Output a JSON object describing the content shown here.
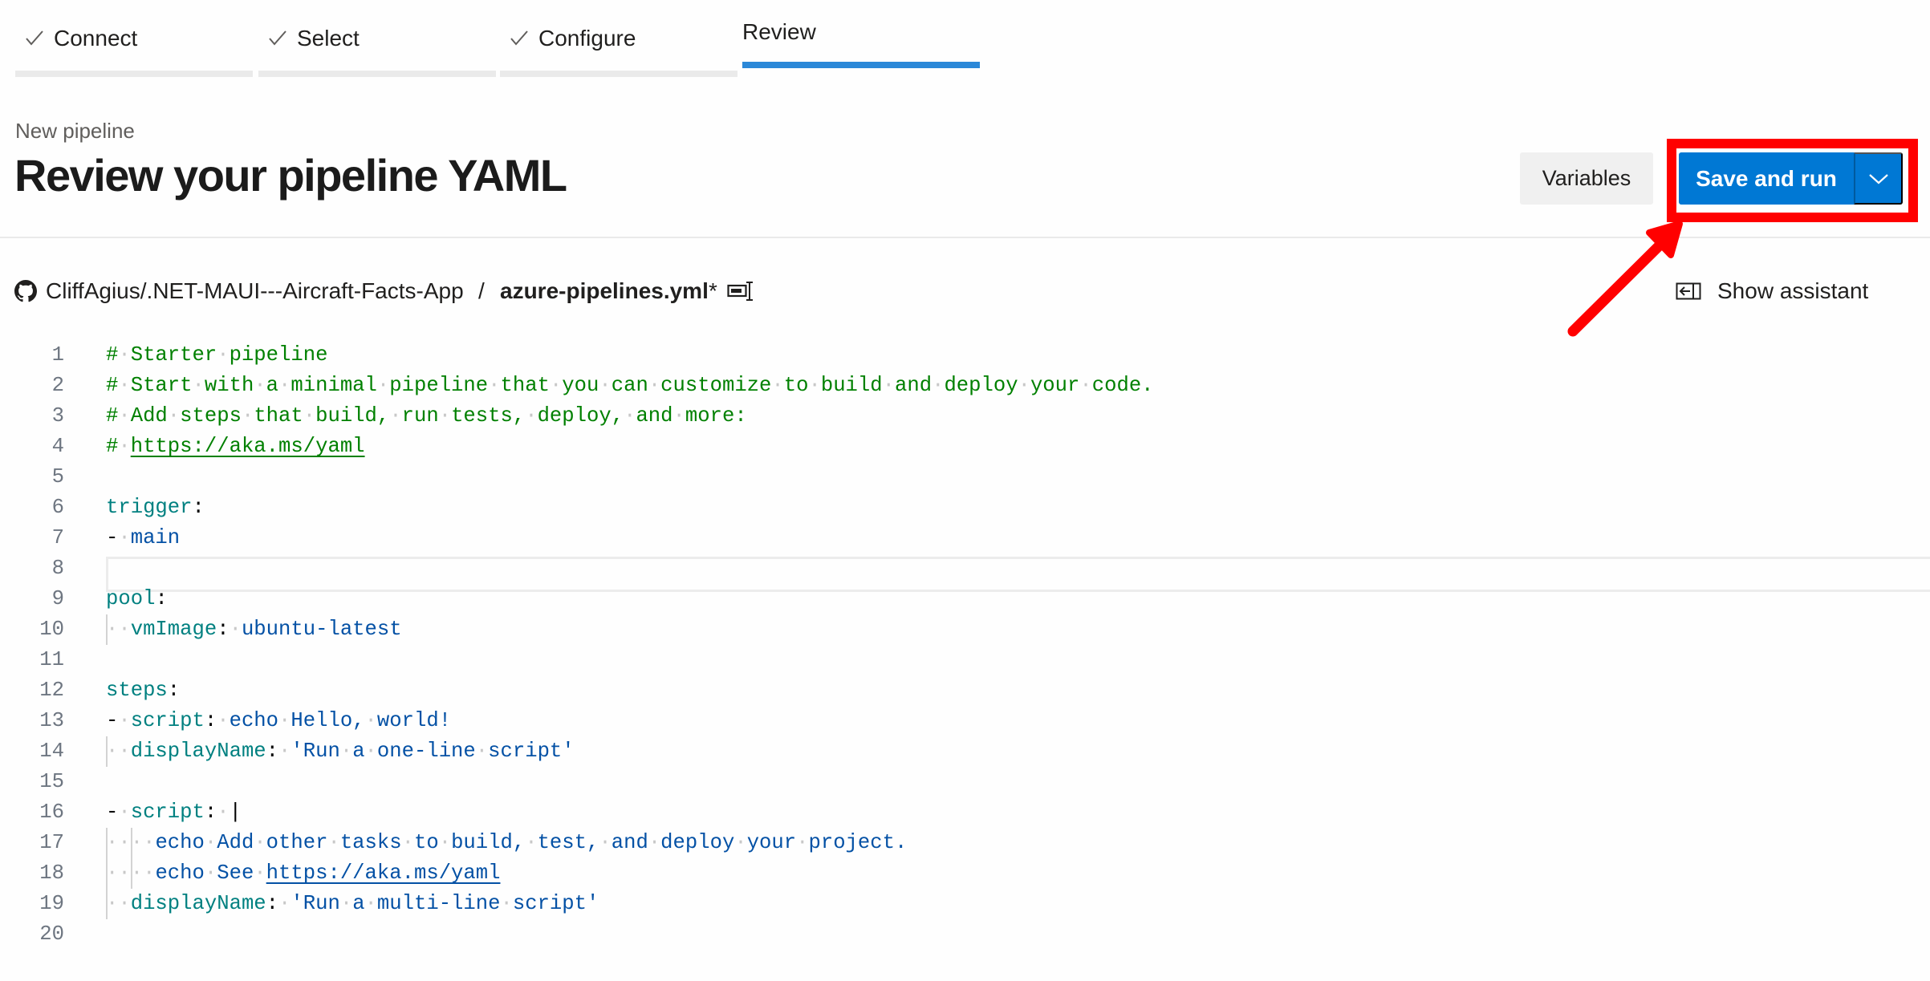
{
  "wizard": {
    "tabs": [
      {
        "label": "Connect",
        "state": "completed",
        "icon": "checkmark-icon"
      },
      {
        "label": "Select",
        "state": "completed",
        "icon": "checkmark-icon"
      },
      {
        "label": "Configure",
        "state": "completed",
        "icon": "checkmark-icon"
      },
      {
        "label": "Review",
        "state": "active"
      }
    ],
    "active_color": "#2b88d8"
  },
  "header": {
    "subtitle": "New pipeline",
    "title": "Review your pipeline YAML",
    "variables_label": "Variables",
    "save_label": "Save and run",
    "primary_color": "#0078d4",
    "annotation_color": "#ff0000"
  },
  "breadcrumb": {
    "repo_icon": "github-icon",
    "repo": "CliffAgius/.NET-MAUI---Aircraft-Facts-App",
    "separator": "/",
    "file": "azure-pipelines.yml",
    "modified_marker": "*",
    "rename_icon": "rename-icon"
  },
  "assistant": {
    "label": "Show assistant",
    "icon": "panel-open-icon"
  },
  "editor": {
    "current_line": 8,
    "lines": [
      {
        "n": "1",
        "tokens": [
          [
            "c-comment",
            "#"
          ],
          [
            "ws",
            "·"
          ],
          [
            "c-comment",
            "Starter"
          ],
          [
            "ws",
            "·"
          ],
          [
            "c-comment",
            "pipeline"
          ]
        ]
      },
      {
        "n": "2",
        "tokens": [
          [
            "c-comment",
            "#"
          ],
          [
            "ws",
            "·"
          ],
          [
            "c-comment",
            "Start"
          ],
          [
            "ws",
            "·"
          ],
          [
            "c-comment",
            "with"
          ],
          [
            "ws",
            "·"
          ],
          [
            "c-comment",
            "a"
          ],
          [
            "ws",
            "·"
          ],
          [
            "c-comment",
            "minimal"
          ],
          [
            "ws",
            "·"
          ],
          [
            "c-comment",
            "pipeline"
          ],
          [
            "ws",
            "·"
          ],
          [
            "c-comment",
            "that"
          ],
          [
            "ws",
            "·"
          ],
          [
            "c-comment",
            "you"
          ],
          [
            "ws",
            "·"
          ],
          [
            "c-comment",
            "can"
          ],
          [
            "ws",
            "·"
          ],
          [
            "c-comment",
            "customize"
          ],
          [
            "ws",
            "·"
          ],
          [
            "c-comment",
            "to"
          ],
          [
            "ws",
            "·"
          ],
          [
            "c-comment",
            "build"
          ],
          [
            "ws",
            "·"
          ],
          [
            "c-comment",
            "and"
          ],
          [
            "ws",
            "·"
          ],
          [
            "c-comment",
            "deploy"
          ],
          [
            "ws",
            "·"
          ],
          [
            "c-comment",
            "your"
          ],
          [
            "ws",
            "·"
          ],
          [
            "c-comment",
            "code."
          ]
        ]
      },
      {
        "n": "3",
        "tokens": [
          [
            "c-comment",
            "#"
          ],
          [
            "ws",
            "·"
          ],
          [
            "c-comment",
            "Add"
          ],
          [
            "ws",
            "·"
          ],
          [
            "c-comment",
            "steps"
          ],
          [
            "ws",
            "·"
          ],
          [
            "c-comment",
            "that"
          ],
          [
            "ws",
            "·"
          ],
          [
            "c-comment",
            "build,"
          ],
          [
            "ws",
            "·"
          ],
          [
            "c-comment",
            "run"
          ],
          [
            "ws",
            "·"
          ],
          [
            "c-comment",
            "tests,"
          ],
          [
            "ws",
            "·"
          ],
          [
            "c-comment",
            "deploy,"
          ],
          [
            "ws",
            "·"
          ],
          [
            "c-comment",
            "and"
          ],
          [
            "ws",
            "·"
          ],
          [
            "c-comment",
            "more:"
          ]
        ]
      },
      {
        "n": "4",
        "tokens": [
          [
            "c-comment",
            "#"
          ],
          [
            "ws",
            "·"
          ],
          [
            "c-comment c-link",
            "https://aka.ms/yaml"
          ]
        ]
      },
      {
        "n": "5",
        "tokens": []
      },
      {
        "n": "6",
        "tokens": [
          [
            "c-key",
            "trigger"
          ],
          [
            "c-punc",
            ":"
          ]
        ]
      },
      {
        "n": "7",
        "tokens": [
          [
            "c-punc",
            "-"
          ],
          [
            "ws",
            "·"
          ],
          [
            "c-val",
            "main"
          ]
        ]
      },
      {
        "n": "8",
        "tokens": []
      },
      {
        "n": "9",
        "tokens": [
          [
            "c-key",
            "pool"
          ],
          [
            "c-punc",
            ":"
          ]
        ]
      },
      {
        "n": "10",
        "tokens": [
          [
            "ws",
            "··"
          ],
          [
            "c-key",
            "vmImage"
          ],
          [
            "c-punc",
            ":"
          ],
          [
            "ws",
            "·"
          ],
          [
            "c-val",
            "ubuntu-latest"
          ]
        ]
      },
      {
        "n": "11",
        "tokens": []
      },
      {
        "n": "12",
        "tokens": [
          [
            "c-key",
            "steps"
          ],
          [
            "c-punc",
            ":"
          ]
        ]
      },
      {
        "n": "13",
        "tokens": [
          [
            "c-punc",
            "-"
          ],
          [
            "ws",
            "·"
          ],
          [
            "c-key",
            "script"
          ],
          [
            "c-punc",
            ":"
          ],
          [
            "ws",
            "·"
          ],
          [
            "c-val",
            "echo"
          ],
          [
            "ws",
            "·"
          ],
          [
            "c-val",
            "Hello,"
          ],
          [
            "ws",
            "·"
          ],
          [
            "c-val",
            "world!"
          ]
        ]
      },
      {
        "n": "14",
        "tokens": [
          [
            "ws",
            "··"
          ],
          [
            "c-key",
            "displayName"
          ],
          [
            "c-punc",
            ":"
          ],
          [
            "ws",
            "·"
          ],
          [
            "c-val",
            "'Run"
          ],
          [
            "ws",
            "·"
          ],
          [
            "c-val",
            "a"
          ],
          [
            "ws",
            "·"
          ],
          [
            "c-val",
            "one-line"
          ],
          [
            "ws",
            "·"
          ],
          [
            "c-val",
            "script'"
          ]
        ]
      },
      {
        "n": "15",
        "tokens": []
      },
      {
        "n": "16",
        "tokens": [
          [
            "c-punc",
            "-"
          ],
          [
            "ws",
            "·"
          ],
          [
            "c-key",
            "script"
          ],
          [
            "c-punc",
            ":"
          ],
          [
            "ws",
            "·"
          ],
          [
            "c-punc",
            "|"
          ]
        ]
      },
      {
        "n": "17",
        "tokens": [
          [
            "ws",
            "····"
          ],
          [
            "c-val",
            "echo"
          ],
          [
            "ws",
            "·"
          ],
          [
            "c-val",
            "Add"
          ],
          [
            "ws",
            "·"
          ],
          [
            "c-val",
            "other"
          ],
          [
            "ws",
            "·"
          ],
          [
            "c-val",
            "tasks"
          ],
          [
            "ws",
            "·"
          ],
          [
            "c-val",
            "to"
          ],
          [
            "ws",
            "·"
          ],
          [
            "c-val",
            "build,"
          ],
          [
            "ws",
            "·"
          ],
          [
            "c-val",
            "test,"
          ],
          [
            "ws",
            "·"
          ],
          [
            "c-val",
            "and"
          ],
          [
            "ws",
            "·"
          ],
          [
            "c-val",
            "deploy"
          ],
          [
            "ws",
            "·"
          ],
          [
            "c-val",
            "your"
          ],
          [
            "ws",
            "·"
          ],
          [
            "c-val",
            "project."
          ]
        ]
      },
      {
        "n": "18",
        "tokens": [
          [
            "ws",
            "····"
          ],
          [
            "c-val",
            "echo"
          ],
          [
            "ws",
            "·"
          ],
          [
            "c-val",
            "See"
          ],
          [
            "ws",
            "·"
          ],
          [
            "c-val c-link",
            "https://aka.ms/yaml"
          ]
        ]
      },
      {
        "n": "19",
        "tokens": [
          [
            "ws",
            "··"
          ],
          [
            "c-key",
            "displayName"
          ],
          [
            "c-punc",
            ":"
          ],
          [
            "ws",
            "·"
          ],
          [
            "c-val",
            "'Run"
          ],
          [
            "ws",
            "·"
          ],
          [
            "c-val",
            "a"
          ],
          [
            "ws",
            "·"
          ],
          [
            "c-val",
            "multi-line"
          ],
          [
            "ws",
            "·"
          ],
          [
            "c-val",
            "script'"
          ]
        ]
      },
      {
        "n": "20",
        "tokens": []
      }
    ],
    "colors": {
      "comment": "#008000",
      "key": "#008080",
      "value": "#0451a5"
    }
  }
}
